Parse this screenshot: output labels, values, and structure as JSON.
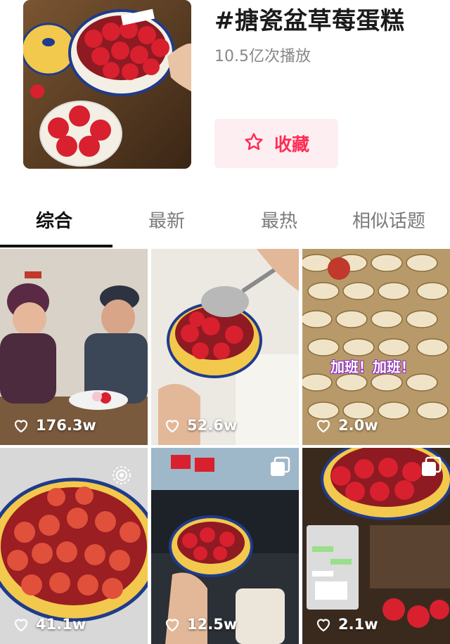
{
  "topic": {
    "title": "#搪瓷盆草莓蛋糕",
    "plays": "10.5亿次播放",
    "favorite_label": "收藏"
  },
  "tabs": [
    {
      "label": "综合",
      "active": true
    },
    {
      "label": "最新",
      "active": false
    },
    {
      "label": "最热",
      "active": false
    },
    {
      "label": "相似话题",
      "active": false
    }
  ],
  "videos": [
    {
      "likes": "176.3w",
      "scene": "elderly couple eating cake"
    },
    {
      "likes": "52.6w",
      "scene": "spoon scooping strawberry cake"
    },
    {
      "likes": "2.0w",
      "scene": "stacked enamel bowls",
      "overlay_text": "加班！加班！"
    },
    {
      "likes": "41.1w",
      "scene": "strawberry cake bowl closeup",
      "badge": "live-icon"
    },
    {
      "likes": "12.5w",
      "scene": "cake in car",
      "badge": "multi-image-icon"
    },
    {
      "likes": "2.1w",
      "scene": "chat screenshot with cake",
      "badge": "multi-image-icon"
    }
  ],
  "colors": {
    "accent": "#fe2c55",
    "fav_bg": "#fdeef1",
    "enamel_yellow": "#f2c94c",
    "enamel_rim": "#1f3b8c",
    "strawberry": "#d8202f"
  }
}
